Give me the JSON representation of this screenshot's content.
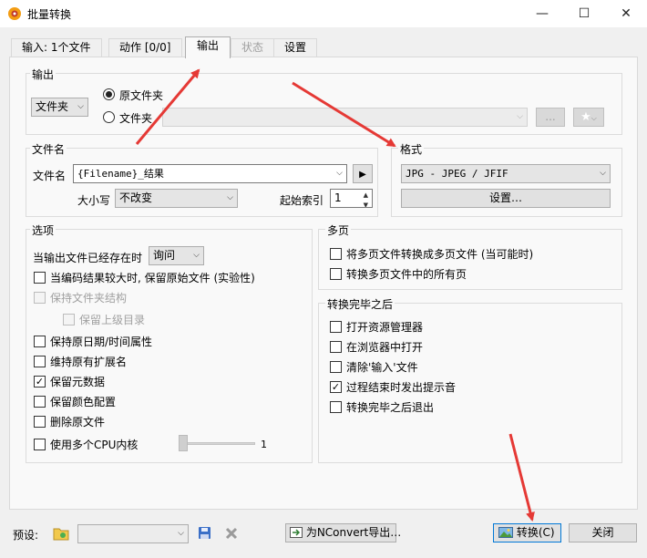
{
  "window": {
    "title": "批量转换",
    "minimize_glyph": "—",
    "maximize_glyph": "☐",
    "close_glyph": "✕"
  },
  "tabs": [
    {
      "label": "输入: 1个文件"
    },
    {
      "label": "动作 [0/0]"
    },
    {
      "label": "输出"
    },
    {
      "label": "状态"
    },
    {
      "label": "设置"
    }
  ],
  "output": {
    "group_title": "输出",
    "dest_combo": "文件夹",
    "radio_original": "原文件夹",
    "radio_folder": "文件夹",
    "browse_label": "...",
    "star_glyph": "★"
  },
  "filename": {
    "group_title": "文件名",
    "label": "文件名",
    "value": "{Filename}_结果",
    "play_glyph": "▶",
    "case_label": "大小写",
    "case_value": "不改变",
    "start_index_label": "起始索引",
    "start_index_value": "1"
  },
  "format": {
    "group_title": "格式",
    "value": "JPG - JPEG / JFIF",
    "settings_label": "设置…"
  },
  "options": {
    "group_title": "选项",
    "exists_label": "当输出文件已经存在时",
    "exists_value": "询问",
    "items": [
      {
        "label": "当编码结果较大时, 保留原始文件 (实验性)",
        "checked": false
      },
      {
        "label": "保持文件夹结构",
        "checked": false
      },
      {
        "label": "保留上级目录",
        "checked": false
      },
      {
        "label": "保持原日期/时间属性",
        "checked": false
      },
      {
        "label": "维持原有扩展名",
        "checked": false
      },
      {
        "label": "保留元数据",
        "checked": true
      },
      {
        "label": "保留颜色配置",
        "checked": false
      },
      {
        "label": "删除原文件",
        "checked": false
      },
      {
        "label": "使用多个CPU内核",
        "checked": false
      }
    ],
    "cpu_slider_value": "1"
  },
  "multipage": {
    "group_title": "多页",
    "items": [
      {
        "label": "将多页文件转换成多页文件 (当可能时)",
        "checked": false
      },
      {
        "label": "转换多页文件中的所有页",
        "checked": false
      }
    ]
  },
  "after": {
    "group_title": "转换完毕之后",
    "items": [
      {
        "label": "打开资源管理器",
        "checked": false
      },
      {
        "label": "在浏览器中打开",
        "checked": false
      },
      {
        "label": "清除'输入'文件",
        "checked": false
      },
      {
        "label": "过程结束时发出提示音",
        "checked": true
      },
      {
        "label": "转换完毕之后退出",
        "checked": false
      }
    ]
  },
  "footer": {
    "preset_label": "预设:",
    "export_label": "为NConvert导出…",
    "convert_label": "转换(C)",
    "close_label": "关闭"
  },
  "colors": {
    "annotation_arrow": "#e53935",
    "accent": "#0078d7"
  }
}
